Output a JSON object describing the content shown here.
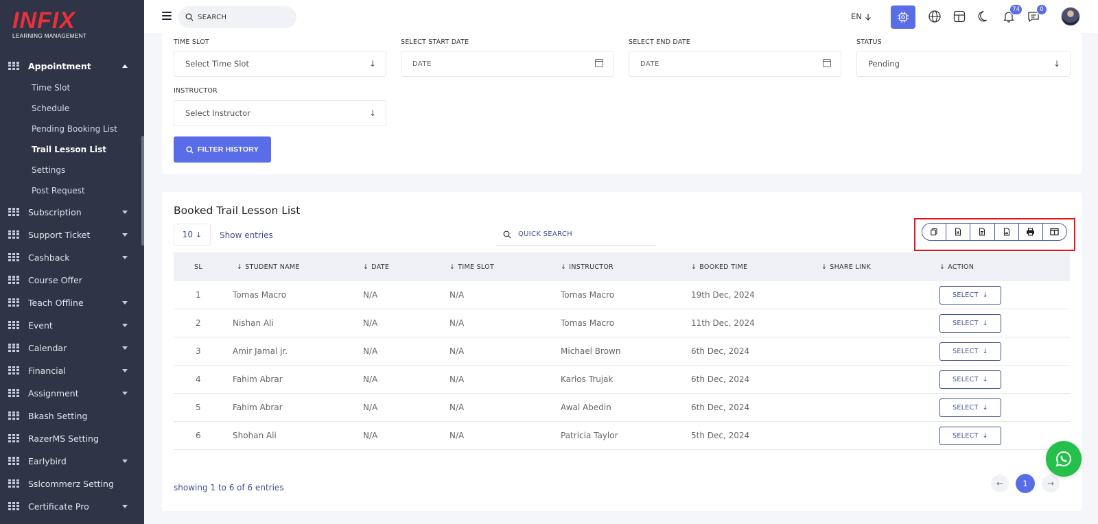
{
  "brand": {
    "name": "INFIX",
    "tagline": "LEARNING MANAGEMENT"
  },
  "sidebar": {
    "active_section": {
      "label": "Appointment",
      "icon": "grid-icon"
    },
    "submenu": [
      {
        "label": "Time Slot"
      },
      {
        "label": "Schedule"
      },
      {
        "label": "Pending Booking List"
      },
      {
        "label": "Trail Lesson List",
        "current": true
      },
      {
        "label": "Settings"
      },
      {
        "label": "Post Request"
      }
    ],
    "items": [
      {
        "label": "Subscription",
        "has_caret": true
      },
      {
        "label": "Support Ticket",
        "has_caret": true
      },
      {
        "label": "Cashback",
        "has_caret": true
      },
      {
        "label": "Course Offer",
        "has_caret": false
      },
      {
        "label": "Teach Offline",
        "has_caret": true
      },
      {
        "label": "Event",
        "has_caret": true
      },
      {
        "label": "Calendar",
        "has_caret": true
      },
      {
        "label": "Financial",
        "has_caret": true
      },
      {
        "label": "Assignment",
        "has_caret": true
      },
      {
        "label": "Bkash Setting",
        "has_caret": false
      },
      {
        "label": "RazerMS Setting",
        "has_caret": false
      },
      {
        "label": "Earlybird",
        "has_caret": true
      },
      {
        "label": "Sslcommerz Setting",
        "has_caret": false
      },
      {
        "label": "Certificate Pro",
        "has_caret": true
      }
    ]
  },
  "topbar": {
    "search_placeholder": "SEARCH",
    "language": "EN",
    "notifications_count": "74",
    "messages_count": "0"
  },
  "filters": {
    "time_slot": {
      "label": "TIME SLOT",
      "value": "Select Time Slot"
    },
    "start_date": {
      "label": "SELECT START DATE",
      "placeholder": "DATE"
    },
    "end_date": {
      "label": "SELECT END DATE",
      "placeholder": "DATE"
    },
    "status": {
      "label": "STATUS",
      "value": "Pending"
    },
    "instructor": {
      "label": "INSTRUCTOR",
      "value": "Select Instructor"
    },
    "filter_button": "FILTER HISTORY"
  },
  "table": {
    "title": "Booked Trail Lesson List",
    "entries_value": "10",
    "entries_label": "Show entries",
    "quick_search_placeholder": "QUICK SEARCH",
    "export_buttons": [
      "copy-icon",
      "excel-icon",
      "csv-icon",
      "pdf-icon",
      "print-icon",
      "columns-icon"
    ],
    "columns": {
      "sl": "SL",
      "student": "STUDENT NAME",
      "date": "DATE",
      "slot": "TIME SLOT",
      "instructor": "INSTRUCTOR",
      "booked": "BOOKED TIME",
      "share": "SHARE LINK",
      "action": "ACTION"
    },
    "rows": [
      {
        "sl": "1",
        "student": "Tomas Macro",
        "date": "N/A",
        "slot": "N/A",
        "instructor": "Tomas Macro",
        "booked": "19th Dec, 2024",
        "share": "",
        "action": "SELECT"
      },
      {
        "sl": "2",
        "student": "Nishan Ali",
        "date": "N/A",
        "slot": "N/A",
        "instructor": "Tomas Macro",
        "booked": "11th Dec, 2024",
        "share": "",
        "action": "SELECT"
      },
      {
        "sl": "3",
        "student": "Amir Jamal jr.",
        "date": "N/A",
        "slot": "N/A",
        "instructor": "Michael Brown",
        "booked": "6th Dec, 2024",
        "share": "",
        "action": "SELECT"
      },
      {
        "sl": "4",
        "student": "Fahim Abrar",
        "date": "N/A",
        "slot": "N/A",
        "instructor": "Karlos Trujak",
        "booked": "6th Dec, 2024",
        "share": "",
        "action": "SELECT"
      },
      {
        "sl": "5",
        "student": "Fahim Abrar",
        "date": "N/A",
        "slot": "N/A",
        "instructor": "Awal Abedin",
        "booked": "6th Dec, 2024",
        "share": "",
        "action": "SELECT"
      },
      {
        "sl": "6",
        "student": "Shohan Ali",
        "date": "N/A",
        "slot": "N/A",
        "instructor": "Patricia Taylor",
        "booked": "5th Dec, 2024",
        "share": "",
        "action": "SELECT"
      }
    ],
    "showing_text": "showing 1 to 6 of 6 entries",
    "current_page": "1"
  }
}
